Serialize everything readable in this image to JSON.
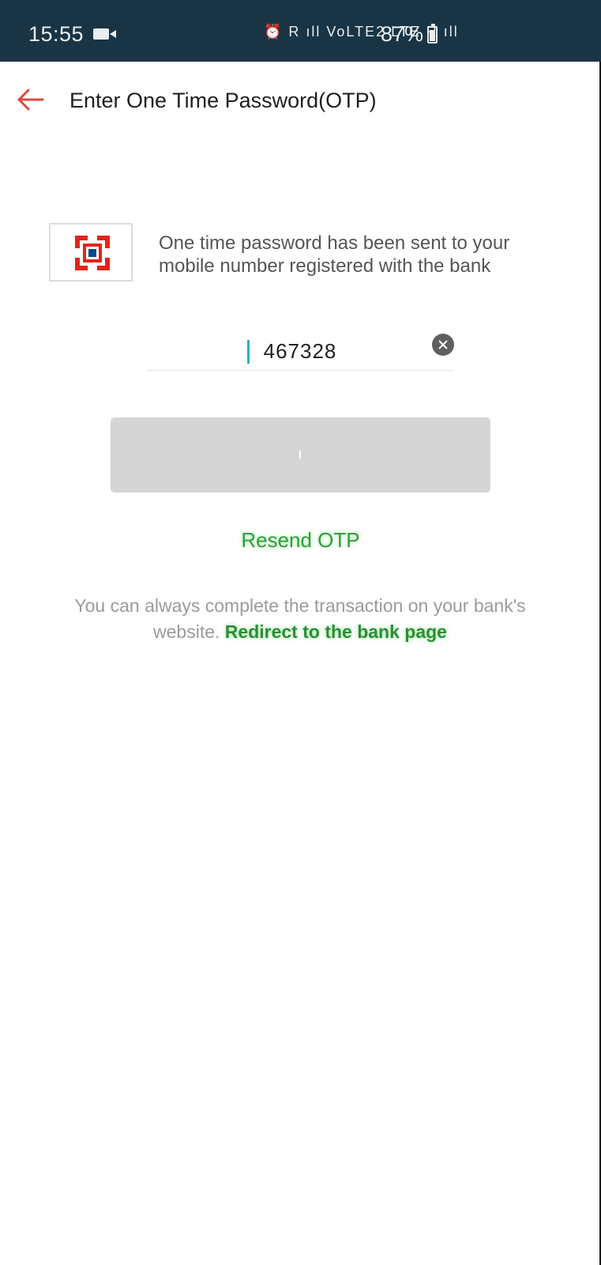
{
  "status_bar": {
    "time": "15:55",
    "network_icons": "⏰ R ıll VoLTE2 LTE R ıll",
    "battery": "87%"
  },
  "header": {
    "title": "Enter One Time Password(OTP)",
    "back_icon": "arrow-left-icon",
    "back_color": "#d94a3f"
  },
  "info": {
    "message": "One time password has been sent to your mobile number registered with the bank",
    "logo_colors": {
      "red": "#e1251b",
      "blue": "#004b8d"
    }
  },
  "otp": {
    "value": "467328",
    "clear_icon": "clear-icon"
  },
  "actions": {
    "submit_label": "",
    "resend_label": "Resend OTP"
  },
  "footer": {
    "text": "You can always complete the transaction on your bank's website.",
    "link": "Redirect to the bank page"
  },
  "colors": {
    "status_bar": "#193545",
    "accent_green": "#2f9e3a",
    "disabled_button": "#d5d5d5"
  }
}
